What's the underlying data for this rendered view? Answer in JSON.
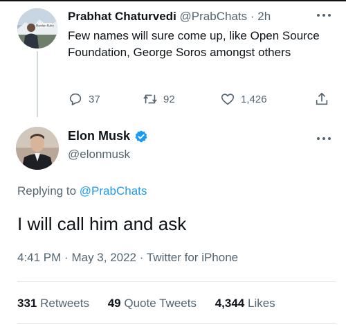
{
  "reply_tweet": {
    "author_name": "Prabhat Chaturvedi",
    "author_handle": "@PrabChats",
    "separator": "·",
    "time_ago": "2h",
    "text": "Few names will sure come up, like Open Source Foundation, George Soros amongst others",
    "reply_count": "37",
    "retweet_count": "92",
    "like_count": "1,426",
    "avatar_text": "Harden Kuhn"
  },
  "main_tweet": {
    "author_name": "Elon Musk",
    "author_handle": "@elonmusk",
    "replying_prefix": "Replying to",
    "replying_to": "@PrabChats",
    "text": "I will call him and ask",
    "time": "4:41 PM",
    "dot": "·",
    "date": "May 3, 2022",
    "source": "Twitter for iPhone"
  },
  "stats": {
    "retweets_count": "331",
    "retweets_label": "Retweets",
    "quote_tweets_count": "49",
    "quote_tweets_label": "Quote Tweets",
    "likes_count": "4,344",
    "likes_label": "Likes"
  },
  "colors": {
    "link": "#1d9bf0",
    "muted": "#536471",
    "text": "#0f1419",
    "verified": "#1d9bf0"
  },
  "icons": [
    "reply-icon",
    "retweet-icon",
    "like-icon",
    "share-icon",
    "more-icon",
    "verified-badge-icon"
  ]
}
